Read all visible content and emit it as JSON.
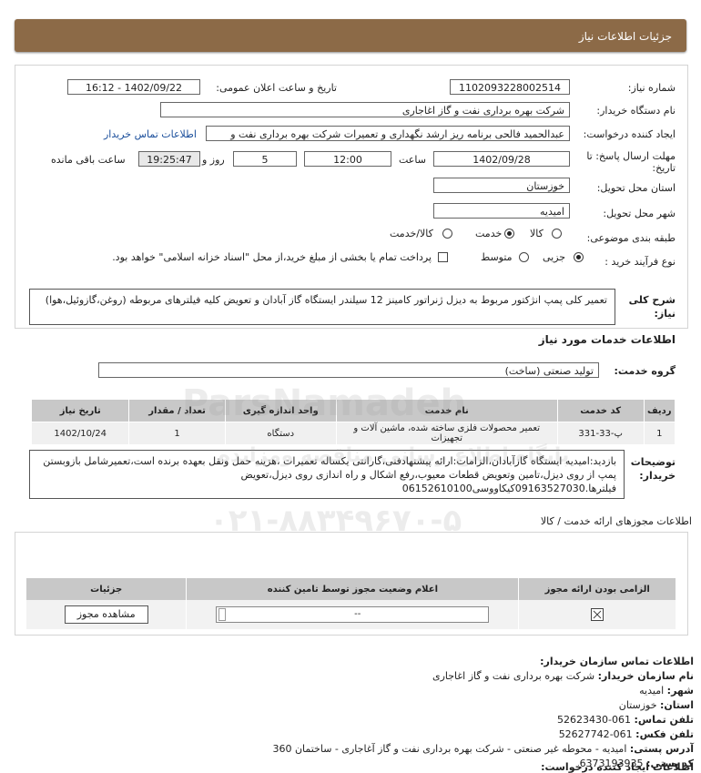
{
  "header": {
    "title": "جزئیات اطلاعات نیاز"
  },
  "form": {
    "need_number_label": "شماره نیاز:",
    "need_number": "1102093228002514",
    "announce_label": "تاریخ و ساعت اعلان عمومی:",
    "announce_value": "1402/09/22 - 16:12",
    "buyer_label": "نام دستگاه خریدار:",
    "buyer_value": "شرکت بهره برداری نفت و گاز اغاجاری",
    "requester_label": "ایجاد کننده درخواست:",
    "requester_value": "عبدالحمید فالحی برنامه ریز ارشد نگهداری و تعمیرات شرکت بهره برداری نفت و",
    "contact_link": "اطلاعات تماس خریدار",
    "deadline_label_1": "مهلت ارسال پاسخ: تا",
    "deadline_label_2": "تاریخ:",
    "deadline_date": "1402/09/28",
    "hour_label": "ساعت",
    "deadline_time": "12:00",
    "days_value": "5",
    "days_label": "روز و",
    "remaining_time": "19:25:47",
    "remaining_label": "ساعت باقی مانده",
    "province_label": "استان محل تحویل:",
    "province_value": "خوزستان",
    "city_label": "شهر محل تحویل:",
    "city_value": "امیدیه",
    "category_label": "طبقه بندی موضوعی:",
    "category_options": [
      "کالا",
      "خدمت",
      "کالا/خدمت"
    ],
    "category_selected": "خدمت",
    "process_label": "نوع فرآیند خرید :",
    "process_options": [
      "جزیی",
      "متوسط"
    ],
    "process_selected": "جزیی",
    "treasury_text": "پرداخت تمام یا بخشی از مبلغ خرید،از محل \"اسناد خزانه اسلامی\" خواهد بود."
  },
  "summary": {
    "label": "شرح کلی نیاز:",
    "text": "تعمیر کلی پمپ انژکتور مربوط به دیزل ژنراتور کامینز 12 سیلندر ایستگاه گاز آبادان و تعویض کلیه فیلترهای مربوطه (روغن،گازوئیل،هوا)"
  },
  "services": {
    "section_title": "اطلاعات خدمات مورد نیاز",
    "group_label": "گروه خدمت:",
    "group_value": "تولید صنعتی (ساخت)",
    "columns": [
      "ردیف",
      "کد خدمت",
      "نام خدمت",
      "واحد اندازه گیری",
      "تعداد / مقدار",
      "تاریخ نیاز"
    ],
    "rows": [
      [
        "1",
        "پ-33-331",
        "تعمیر محصولات فلزی ساخته شده، ماشین آلات و تجهیزات",
        "دستگاه",
        "1",
        "1402/10/24"
      ]
    ]
  },
  "buyer_notes": {
    "label": "توضیحات خریدار:",
    "text": "بازدید:امیدیه ایستگاه گازآبادان،الزامات:ارائه پیشنهادفنی،گارانتی یکساله تعمیرات ،هزینه حمل ونقل بعهده برنده است،تعمیرشامل بازوبستن پمپ از روی دیزل،تامین وتعویض قطعات معیوب،رفع اشکال و راه اندازی روی دیزل،تعویض فیلترها.09163527030کیکاووسی06152610100"
  },
  "permits": {
    "section_title": "اطلاعات مجوزهای ارائه خدمت / کالا",
    "columns": [
      "الزامی بودن ارائه مجوز",
      "اعلام وضعیت مجوز توسط تامین کننده",
      "جزئیات"
    ],
    "status_value": "--",
    "view_button": "مشاهده مجوز"
  },
  "contact": {
    "title": "اطلاعات تماس سازمان خریدار:",
    "org_label": "نام سازمان خریدار:",
    "org_value": "شرکت بهره برداری نفت و گاز اغاجاری",
    "city_label": "شهر:",
    "city_value": "امیدیه",
    "province_label": "استان:",
    "province_value": "خوزستان",
    "phone_label": "تلفن تماس:",
    "phone_value": "061-52623430",
    "fax_label": "تلفن فکس:",
    "fax_value": "061-52627742",
    "address_label": "آدرس پستی:",
    "address_value": "امیدیه - محوطه غیر صنعتی - شرکت بهره برداری نفت و گاز آغاجاری - ساختمان 360",
    "postal_label": "کد پستی:",
    "postal_value": "6373193935",
    "creator_title": "اطلاعات ایجاد کننده درخواست:"
  },
  "watermark": {
    "brand": "ParsNamadeh",
    "sub": "پایگاه اطلاع رسانی مناقصه ومزایده",
    "phone": "۰۲۱-۸۸۳۴۹۶۷۰-۵"
  },
  "colors": {
    "header_bg": "#8c6a47",
    "link": "#1a4e9b",
    "table_header": "#c8c8c8"
  }
}
